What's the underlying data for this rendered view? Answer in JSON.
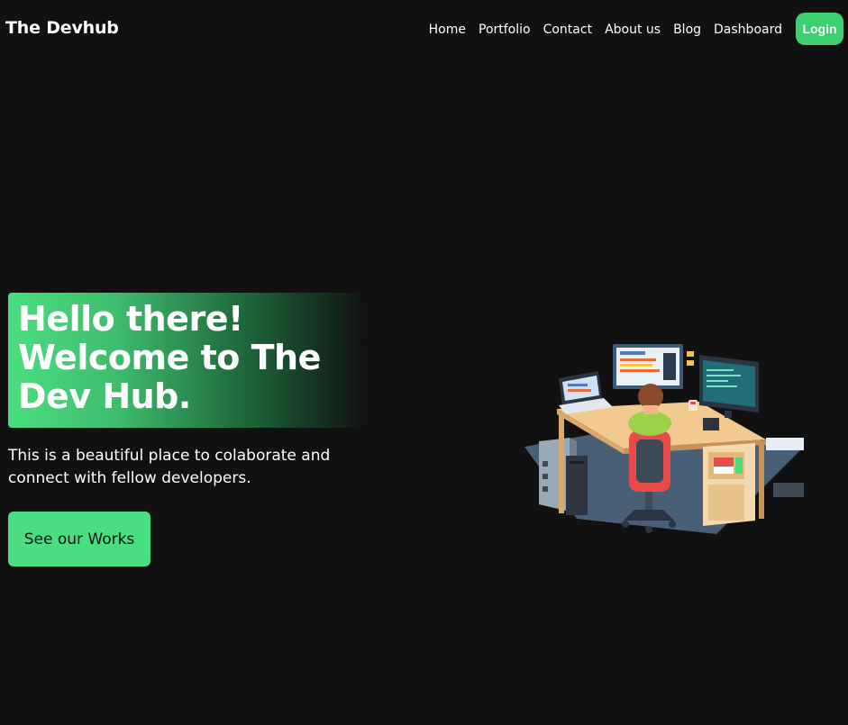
{
  "nav": {
    "logo": "The Devhub",
    "links": [
      "Home",
      "Portfolio",
      "Contact",
      "About us",
      "Blog",
      "Dashboard"
    ],
    "login_label": "Login"
  },
  "hero": {
    "title_line1": "Hello there!",
    "title_line2": "Welcome to The",
    "title_line3": "Dev Hub.",
    "subtitle": "This is a beautiful place to colaborate and connect with fellow developers.",
    "cta_label": "See our Works"
  },
  "colors": {
    "background": "#111111",
    "accent": "#4ade80",
    "login": "#3bd16f"
  }
}
